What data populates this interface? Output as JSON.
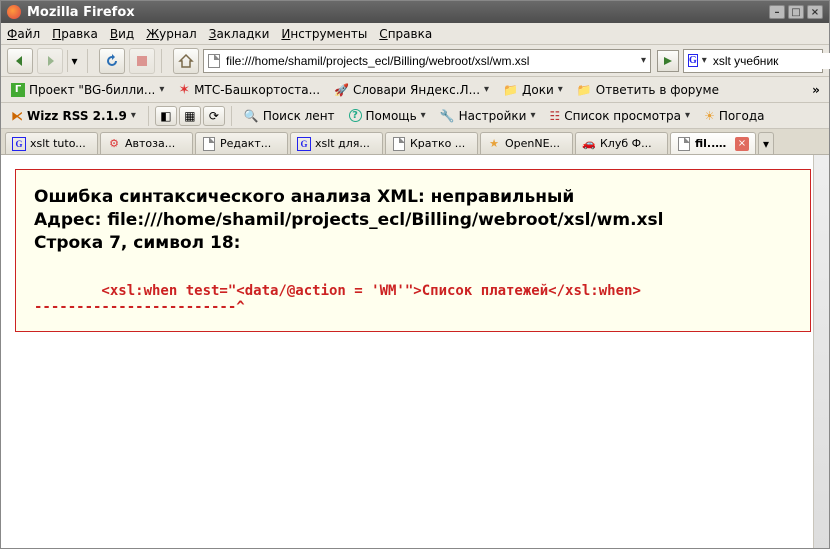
{
  "window": {
    "title": "Mozilla Firefox"
  },
  "menu": {
    "file": "Файл",
    "edit": "Правка",
    "view": "Вид",
    "history": "Журнал",
    "bookmarks": "Закладки",
    "tools": "Инструменты",
    "help": "Справка"
  },
  "nav": {
    "url": "file:///home/shamil/projects_ecl/Billing/webroot/xsl/wm.xsl",
    "search_value": "xslt учебник",
    "search_engine": "G"
  },
  "bookmarks_bar": {
    "items": [
      {
        "label": "Проект \"BG-билли..."
      },
      {
        "label": "МТС-Башкортоста..."
      },
      {
        "label": "Словари Яндекс.Л..."
      },
      {
        "label": "Доки"
      },
      {
        "label": "Ответить в форуме"
      }
    ],
    "overflow": "»"
  },
  "rss_bar": {
    "title": "Wizz RSS 2.1.9",
    "items": [
      {
        "label": "Поиск лент"
      },
      {
        "label": "Помощь"
      },
      {
        "label": "Настройки"
      },
      {
        "label": "Список просмотра"
      },
      {
        "label": "Погода"
      }
    ]
  },
  "tabs": [
    {
      "label": "xslt tuto..."
    },
    {
      "label": "Автоза..."
    },
    {
      "label": "Редакт..."
    },
    {
      "label": "xslt для..."
    },
    {
      "label": "Кратко ..."
    },
    {
      "label": "OpenNE..."
    },
    {
      "label": "Клуб Ф..."
    },
    {
      "label": "fil...sl",
      "active": true,
      "closeable": true
    }
  ],
  "error": {
    "line1": "Ошибка синтаксического анализа XML: неправильный",
    "line2": "Адрес: file:///home/shamil/projects_ecl/Billing/webroot/xsl/wm.xsl",
    "line3": "Строка 7, символ 18:",
    "source": "        <xsl:when test=\"<data/@action = 'WM'\">Список платежей</xsl:when>",
    "marker": "------------------------^"
  }
}
